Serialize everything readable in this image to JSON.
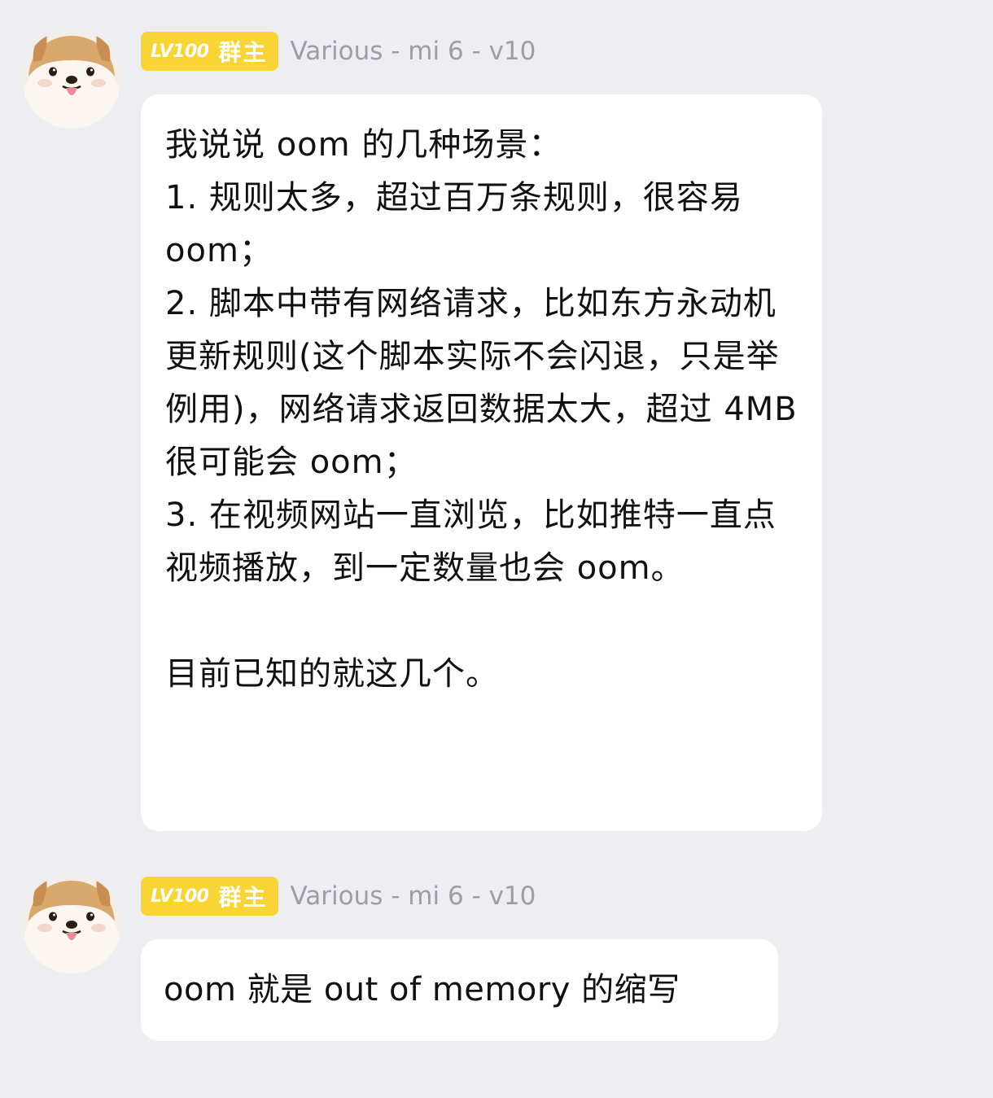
{
  "messages": [
    {
      "sender": {
        "level_badge": "LV100",
        "role_badge": "群主",
        "nickname": "Various - mi 6 - v10",
        "avatar_icon": "shiba-dog-avatar-icon"
      },
      "text": "我说说 oom 的几种场景：\n1. 规则太多，超过百万条规则，很容易 oom；\n2. 脚本中带有网络请求，比如东方永动机更新规则(这个脚本实际不会闪退，只是举例用)，网络请求返回数据太大，超过 4MB 很可能会 oom；\n3. 在视频网站一直浏览，比如推特一直点视频播放，到一定数量也会 oom。\n\n目前已知的就这几个。"
    },
    {
      "sender": {
        "level_badge": "LV100",
        "role_badge": "群主",
        "nickname": "Various - mi 6 - v10",
        "avatar_icon": "shiba-dog-avatar-icon"
      },
      "text": "oom 就是 out of memory 的缩写"
    }
  ],
  "colors": {
    "background": "#ededf2",
    "bubble": "#ffffff",
    "badge": "#f8d534",
    "nickname": "#9d9da5",
    "text": "#111111"
  }
}
